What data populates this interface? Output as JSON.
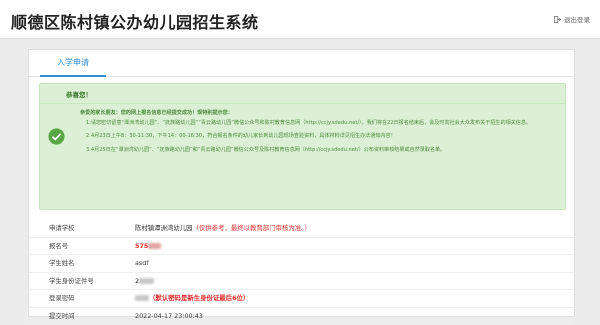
{
  "header": {
    "title": "顺德区陈村镇公办幼儿园招生系统",
    "logout_label": "退出登录"
  },
  "tabs": [
    {
      "label": "入学申请"
    }
  ],
  "alert": {
    "title": "恭喜您！",
    "greeting": "亲爱的家长朋友：您的网上报名信息已经提交成功！现特别提示您：",
    "items": [
      "1.请您密切留意“潭洲湾幼儿园”、“抚族路幼儿园”“青云路幼儿园”微信公众号和陈村教育信息网（http://ccjy.sdedu.net/），我们将在22日报名结束后，会及时向社会大众发布关于招生的相关信息。",
      "2.4月23日上午8：30-11:30，下午14：00-16:30，符合报名条件的幼儿家长到幼儿园现场查验资料，具体材料详见招生办法通知内容！",
      "3.4月25日在“潭洲湾幼儿园”、“抚族路幼儿园”和“青云路幼儿园”微信公众号及陈村教育信息网（http://ccjy.sdedu.net/）公布资料审核结果或自然录取名单。"
    ],
    "colors": {
      "bg": "#dcf0d6",
      "text": "#4b8a3a",
      "icon": "#5aa748"
    }
  },
  "details": {
    "school_label": "申请学校",
    "school_value": "陈村镇潭洲湾幼儿园",
    "school_note": "（仅供参考，最终以教育部门审核为准。）",
    "reg_no_label": "报名号",
    "reg_no_value": "575",
    "student_name_label": "学生姓名",
    "student_name_value": "asdf",
    "id_label": "学生身份证件号",
    "id_value": "2",
    "password_label": "登录密码",
    "password_note": "（默认密码是新生身份证最后6位）",
    "submit_time_label": "提交时间",
    "submit_time_value": "2022-04-17 23:00:43"
  },
  "colors": {
    "accent": "#2e8dd6",
    "warn": "#e0302d"
  }
}
